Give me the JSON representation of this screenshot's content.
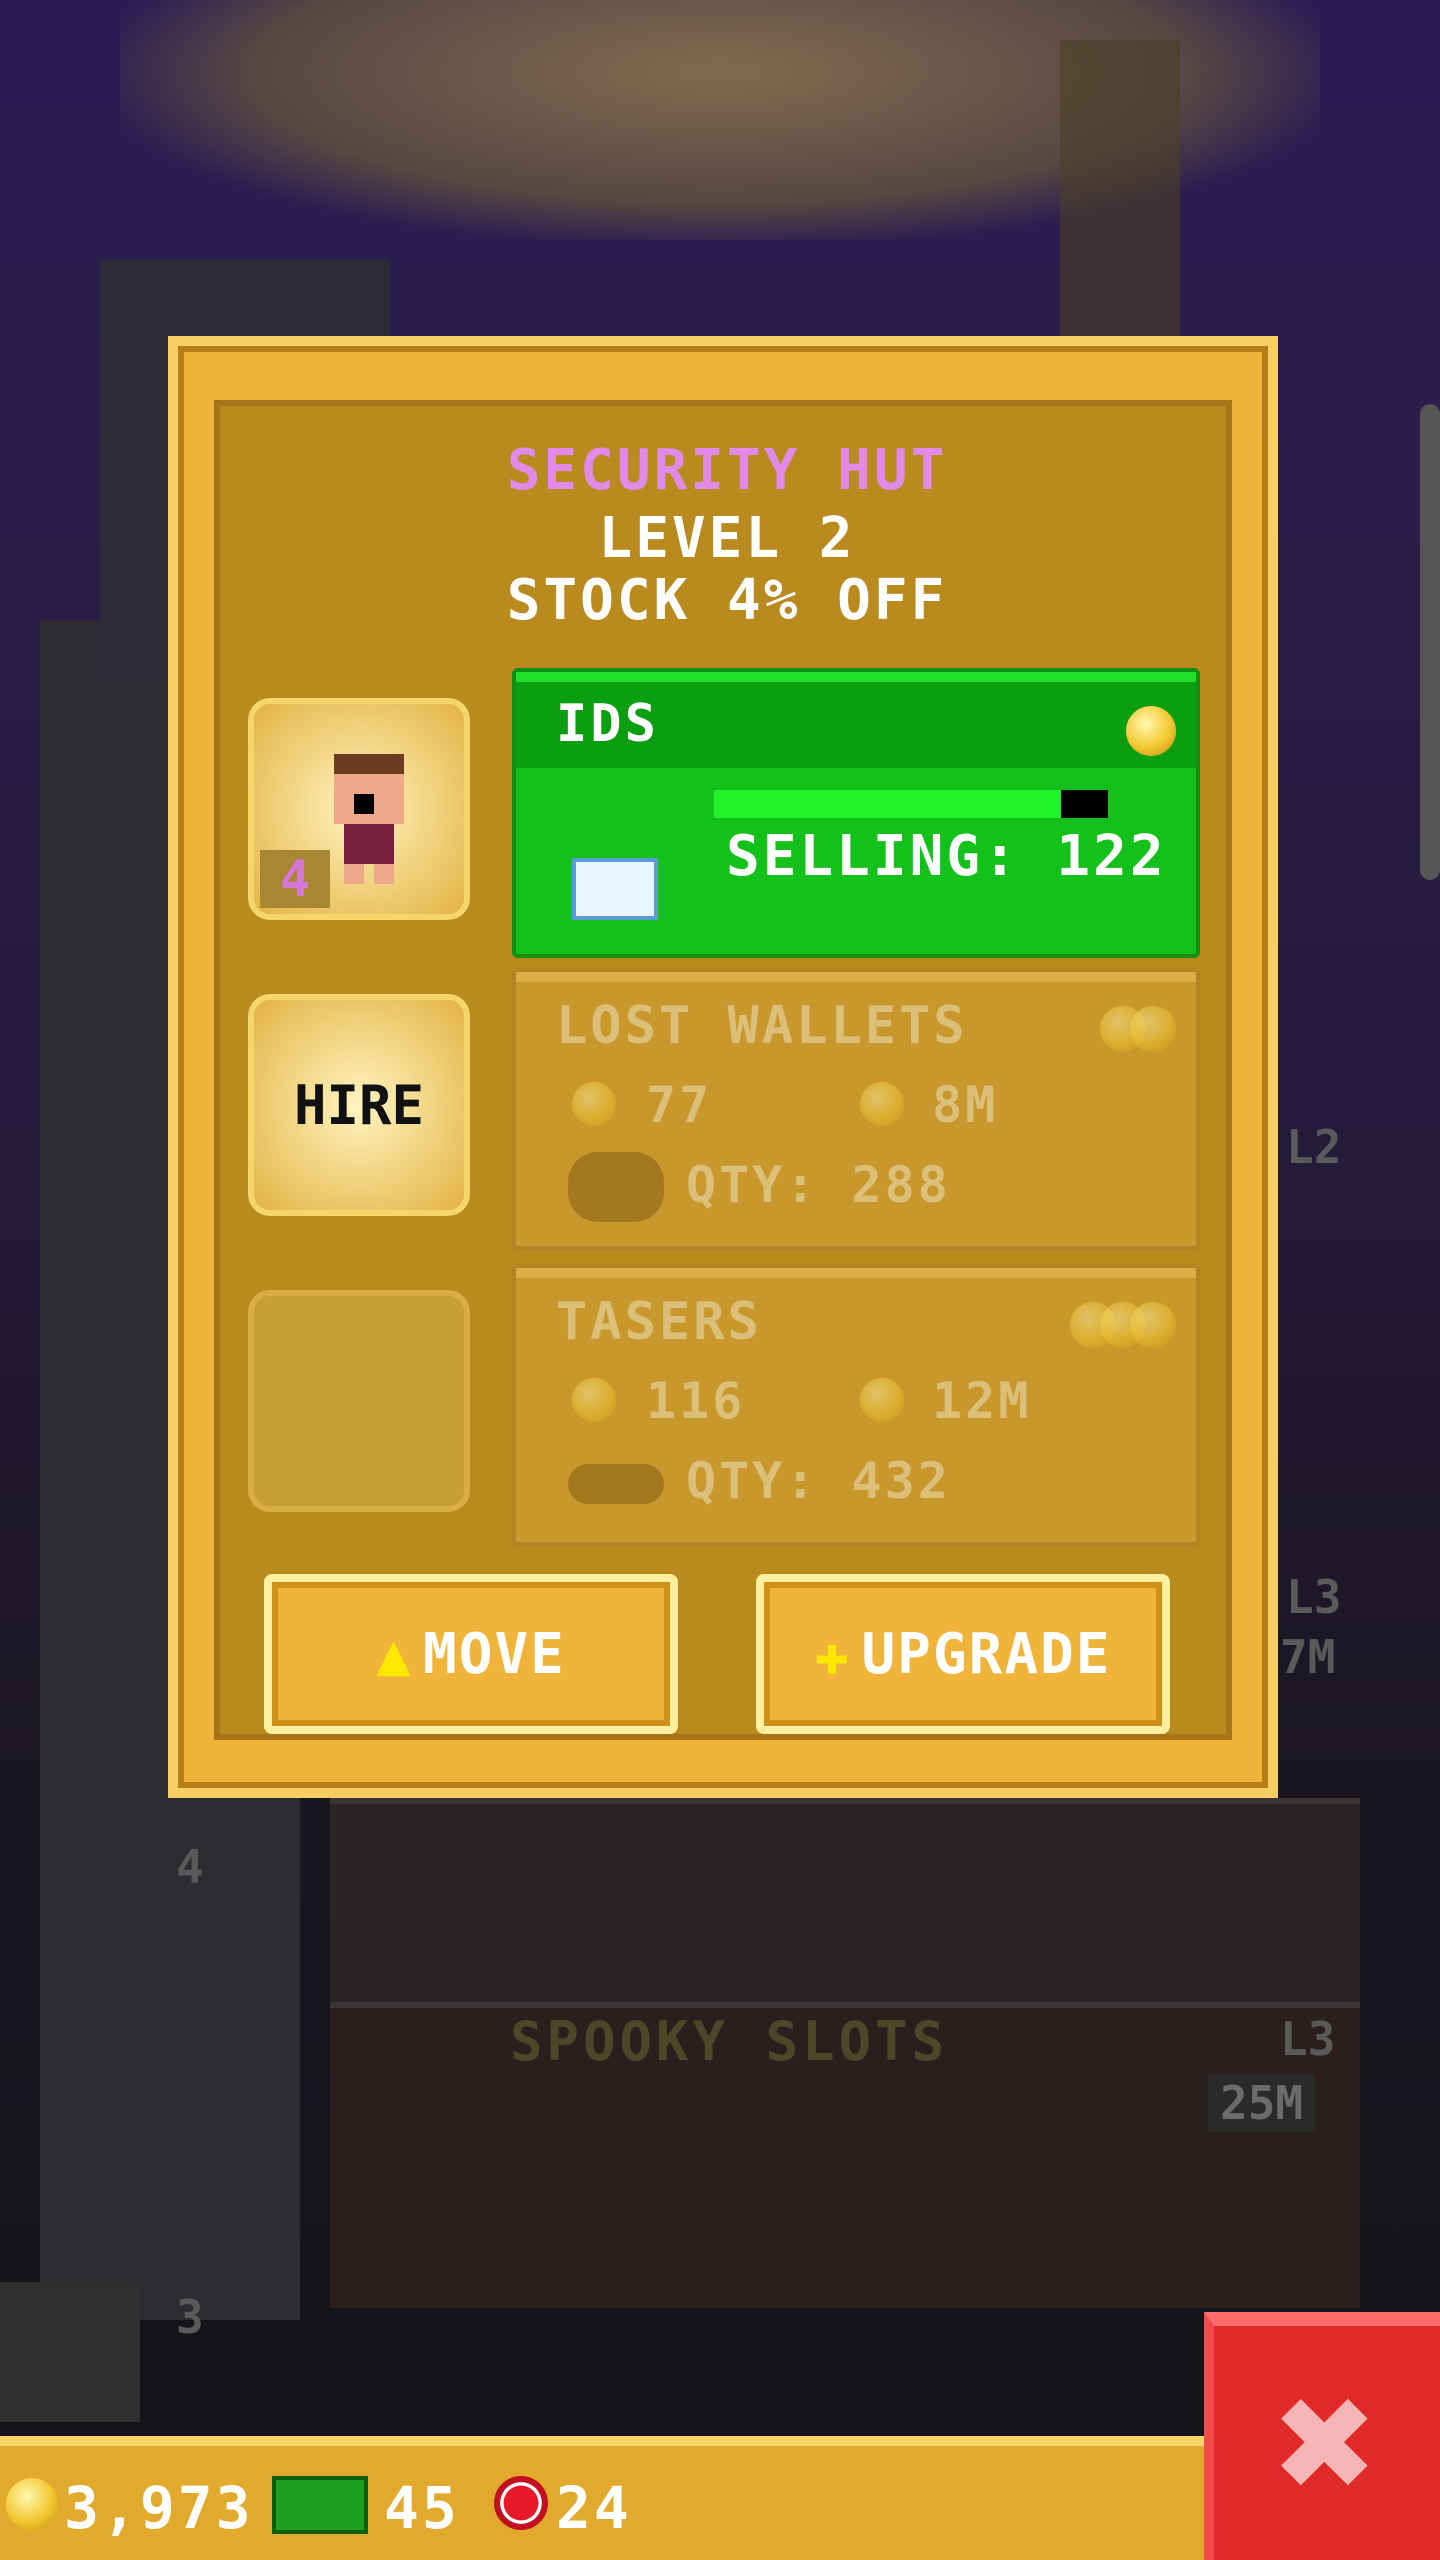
{
  "panel": {
    "title": "SECURITY HUT",
    "level": "LEVEL 2",
    "bonus": "STOCK 4% OFF",
    "staff_level": "4",
    "hire_label": "HIRE",
    "products": [
      {
        "name": "IDS",
        "selling": "SELLING: 122",
        "progress": 0.88
      },
      {
        "name": "LOST WALLETS",
        "cost": "77",
        "time": "8M",
        "qty": "QTY: 288"
      },
      {
        "name": "TASERS",
        "cost": "116",
        "time": "12M",
        "qty": "QTY: 432"
      }
    ],
    "move_label": "MOVE",
    "upgrade_label": "UPGRADE"
  },
  "background": {
    "floor_name": "SPOOKY SLOTS",
    "floor_level": "L3",
    "floor_time": "25M",
    "floor_number_4": "4",
    "floor_number_3": "3",
    "side_l2": "L2",
    "side_l3": "L3",
    "side_time": "7M"
  },
  "status_bar": {
    "coins": "3,973",
    "bux": "45",
    "chips": "24"
  },
  "colors": {
    "title": "#e18ae8",
    "panel": "#f0b43a",
    "active_product": "#13c11a",
    "close": "#e02a2a"
  }
}
